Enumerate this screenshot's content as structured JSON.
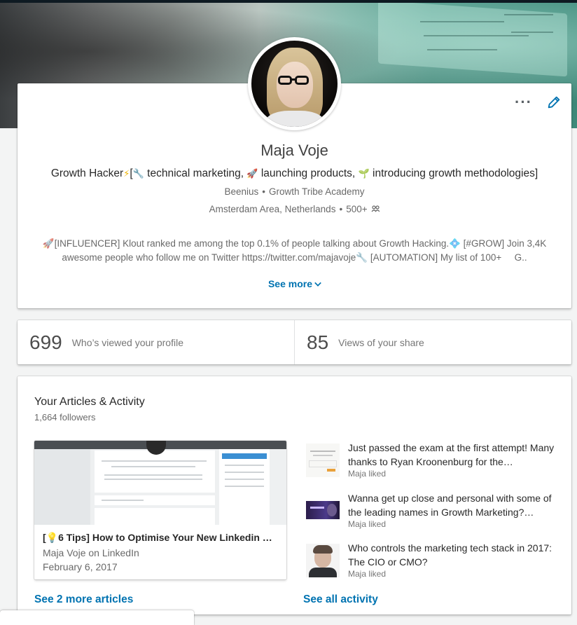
{
  "profile": {
    "name": "Maja Voje",
    "headline_prefix": "Growth Hacker",
    "headline_lightning": "⚡",
    "headline_bracket_open": "[",
    "headline_item1_icon": "🔧",
    "headline_item1": " technical marketing, ",
    "headline_item2_icon": "🚀",
    "headline_item2": " launching products, ",
    "headline_item3_icon": "🌱",
    "headline_item3": " introducing growth methodologies]",
    "company1": "Beenius",
    "company2": "Growth Tribe Academy",
    "location": "Amsterdam Area, Netherlands",
    "connections": "500+",
    "connections_icon": "people-icon",
    "summary": "🚀[INFLUENCER] Klout ranked me among the top 0.1% of people talking about Growth Hacking.💠 [#GROW] Join 3,4K awesome people who follow me on Twitter https://twitter.com/majavoje🔧 [AUTOMATION] My list of 100+  G..",
    "see_more": "See more"
  },
  "stats": [
    {
      "value": "699",
      "label": "Who’s viewed your profile"
    },
    {
      "value": "85",
      "label": "Views of your share"
    }
  ],
  "articles": {
    "title": "Your Articles & Activity",
    "followers": "1,664 followers",
    "article": {
      "title": "[💡6 Tips] How to Optimise Your New Linkedin Pr...",
      "source": "Maja Voje on LinkedIn",
      "date": "February 6, 2017"
    },
    "activity": [
      {
        "text": "Just passed the exam at the first attempt! Many thanks to Ryan Kroonenburg for the…",
        "meta": "Maja liked"
      },
      {
        "text": "Wanna get up close and personal with some of the leading names in Growth Marketing?…",
        "meta": "Maja liked"
      },
      {
        "text": "Who controls the marketing tech stack in 2017: The CIO or CMO?",
        "meta": "Maja liked"
      }
    ],
    "see_more_articles": "See 2 more articles",
    "see_all_activity": "See all activity"
  },
  "colors": {
    "link": "#0073b1",
    "background": "#f3f4f4",
    "card": "#ffffff"
  }
}
